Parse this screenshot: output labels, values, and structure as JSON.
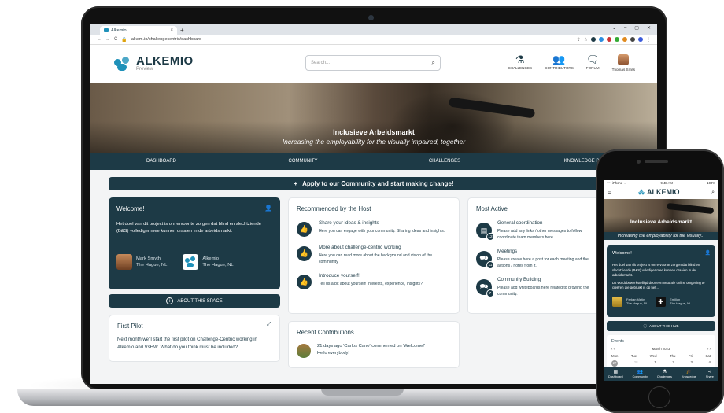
{
  "browser": {
    "tab_title": "Alkemio",
    "tab_close": "×",
    "tab_new": "+",
    "window_controls": [
      "⌄",
      "–",
      "▢",
      "✕"
    ],
    "url": "alkem.io/challengecentric/dashboard"
  },
  "header": {
    "logo_text": "ALKEMIO",
    "logo_sub": "Preview",
    "search_placeholder": "Search...",
    "nav": [
      {
        "label": "CHALLENGES",
        "icon": "challenges-icon"
      },
      {
        "label": "CONTRIBUTORS",
        "icon": "contributors-icon"
      },
      {
        "label": "FORUM",
        "icon": "forum-icon"
      },
      {
        "label": "Thomas Smits",
        "icon": "user-avatar"
      }
    ]
  },
  "banner": {
    "title": "Inclusieve Arbeidsmarkt",
    "subtitle": "Increasing the employability for the visually impaired, together"
  },
  "tabs": [
    "DASHBOARD",
    "COMMUNITY",
    "CHALLENGES",
    "KNOWLEDGE BASE"
  ],
  "apply": {
    "icon": "+",
    "label": "Apply to our Community and start making change!"
  },
  "welcome": {
    "title": "Welcome!",
    "text": "Het doel van dit project is om ervoor te zorgen dat blind en slechtziende (B&S) vollediger mee kunnen draaien in de arbeidsmarkt.",
    "people": [
      {
        "name": "Mark Smyth",
        "location": "The Hague, NL"
      },
      {
        "name": "Alkemio",
        "location": "The Hague, NL"
      }
    ],
    "about_label": "ABOUT THIS SPACE",
    "about_icon": "i"
  },
  "pilot": {
    "title": "First Pilot",
    "text": "Next month we'll start the first pilot on Challenge-Centric working in Alkemio and VsHW. What do you think must be included?"
  },
  "recommended": {
    "title": "Recommended by the Host",
    "items": [
      {
        "title": "Share your ideas & insights",
        "desc": "Here you can engage with your community. Sharing ideas and insights."
      },
      {
        "title": "More about challenge-centric working",
        "desc": "Here you can read more about the background and vision of the community"
      },
      {
        "title": "Introduce yourself!",
        "desc": "Tell us a bit about yourself! Interests, experience, insights?"
      }
    ]
  },
  "recent": {
    "title": "Recent Contributions",
    "item_title": "21 days ago 'Carlos Cano' commented on 'Welcome!'",
    "item_desc": "Hello everybody!"
  },
  "most_active": {
    "title": "Most Active",
    "items": [
      {
        "title": "General coordination",
        "desc": "Please add any links / other messages to follow coordinate team members here.",
        "count": "12"
      },
      {
        "title": "Meetings",
        "desc": "Please create here a post for each meeting and the actions / notes from it.",
        "count": "11"
      },
      {
        "title": "Community Building",
        "desc": "Please add whiteboards here related to growing the community.",
        "count": "7"
      }
    ]
  },
  "phone": {
    "status_left": "•••• iPhone ᯤ",
    "status_time": "9:48 AM",
    "status_right": "100%",
    "logo_text": "ALKEMIO",
    "banner_title": "Inclusieve Arbeidsmarkt",
    "banner_sub": "Increasing the employability for the visually...",
    "welcome_title": "Welcome!",
    "welcome_text": "Het doel van dit project is om ervoor te zorgen dat blind en slechtziende (B&S) volediger mee kunnen draaien in de arbeidsmarkt.",
    "welcome_text2": "Dit wordt bewerkstelligd door een neutrale online omgeving te creëren die gebruikt is op het...",
    "people": [
      {
        "name": "Ferkan Metin",
        "location": "The Hague, NL"
      },
      {
        "name": "Emillon",
        "location": "The Hague, NL"
      }
    ],
    "about_label": "ABOUT THIS HUB",
    "events_title": "Events",
    "month": "March 2023",
    "days": [
      "Mon",
      "Tue",
      "Wed",
      "Thu",
      "Fri",
      "Sat"
    ],
    "dates": [
      "27",
      "28",
      "1",
      "2",
      "3",
      "4"
    ],
    "nav": [
      "Dashboard",
      "Community",
      "Challenges",
      "Knowledge",
      "Share"
    ]
  }
}
